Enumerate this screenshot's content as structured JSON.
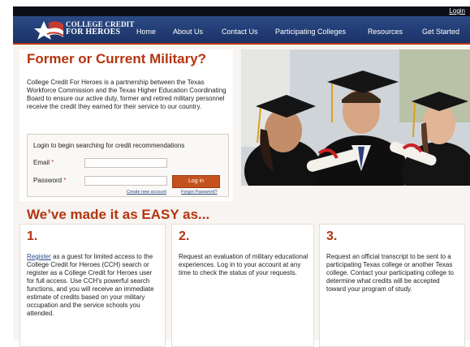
{
  "header": {
    "login_label": "Login",
    "logo_line1": "COLLEGE CREDIT",
    "logo_line2": "FOR HEROES",
    "nav": [
      "Home",
      "About Us",
      "Contact Us",
      "Participating Colleges",
      "Resources",
      "Get Started"
    ]
  },
  "intro": {
    "heading": "Former or Current Military?",
    "paragraph": "College Credit For Heroes is a partnership between the Texas Workforce Commission and the Texas Higher Education Coordinating Board to ensure our active duty, former and retired military personnel receive the credit they earned for their service to our country."
  },
  "login_form": {
    "title": "Login to begin searching for credit recommendations",
    "email_label": "Email",
    "password_label": "Password",
    "required_marker": "*",
    "email_value": "",
    "password_value": "",
    "submit_label": "Log in",
    "create_account_link": "Create new account",
    "forgot_password_link": "Forgot Password?"
  },
  "steps": {
    "heading": "We’ve made it as EASY as...",
    "items": [
      {
        "number": "1.",
        "link": "Register",
        "text": " as a guest for limited access to the College Credit for Heroes (CCH) search or register as a College Credit for Heroes user for full access. Use CCH's powerful search functions, and you will receive an immediate estimate of credits based on your military occupation and the service schools you attended."
      },
      {
        "number": "2.",
        "text": "Request an evaluation of military educational experiences. Log in to your account at any time to check the status of your requests."
      },
      {
        "number": "3.",
        "text": "Request an official transcript to be sent to a participating Texas college or another Texas college. Contact your participating college to determine what credits will be accepted toward your program of study."
      }
    ]
  },
  "colors": {
    "nav_background": "#1b3266",
    "accent": "#b3350f",
    "button": "#c4521e",
    "link": "#2b4a86"
  }
}
